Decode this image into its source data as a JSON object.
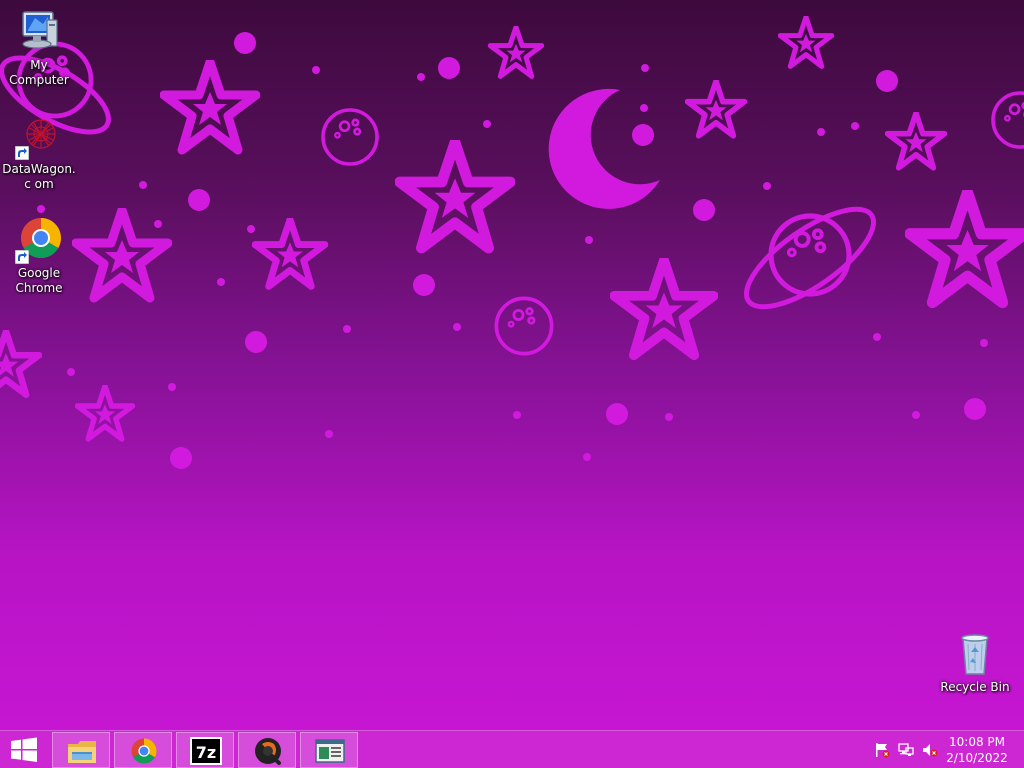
{
  "desktop": {
    "icons": [
      {
        "label": "My Computer",
        "icon": "computer-icon"
      },
      {
        "label": "DataWagon.c om",
        "icon": "datawagon-icon"
      },
      {
        "label": "Google Chrome",
        "icon": "chrome-icon"
      },
      {
        "label": "Recycle Bin",
        "icon": "recycle-bin-icon"
      }
    ]
  },
  "taskbar": {
    "start_icon": "windows-logo-icon",
    "pinned": [
      {
        "icon": "file-explorer-icon"
      },
      {
        "icon": "chrome-icon"
      },
      {
        "icon": "7zip-icon",
        "text": "7z"
      },
      {
        "icon": "quicktime-icon"
      },
      {
        "icon": "app-window-icon"
      }
    ],
    "tray": {
      "icons": [
        "action-center-flag-icon",
        "network-icon",
        "volume-muted-icon"
      ],
      "time": "10:08 PM",
      "date": "2/10/2022"
    }
  },
  "colors": {
    "wallpaper_top": "#3d0a3d",
    "wallpaper_bottom": "#c916d6",
    "shape_color": "#d21adf",
    "taskbar": "#cd28d2"
  }
}
